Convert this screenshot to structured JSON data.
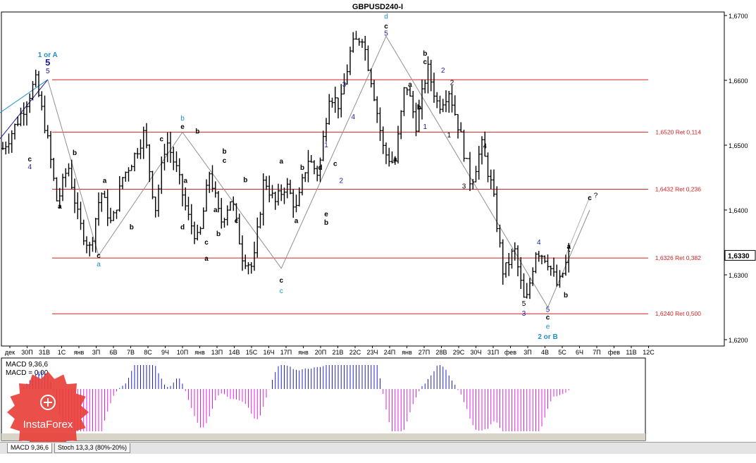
{
  "chart_data": {
    "type": "ohlc",
    "title": "GBPUSD240-I",
    "symbol": "GBPUSD",
    "timeframe": "H4",
    "ylim": [
      1.618,
      1.6715
    ],
    "y_ticks": [
      1.62,
      1.63,
      1.64,
      1.65,
      1.66,
      1.67
    ],
    "y_tick_labels": [
      "1,6200",
      "1,6300",
      "1,6400",
      "1,6500",
      "1,6600",
      "1,6700"
    ],
    "current_price": 1.633,
    "current_price_label": "1,6330",
    "x_tick_labels": [
      "дек",
      "30П",
      "31В",
      "1С",
      "янв",
      "3П",
      "6В",
      "7В",
      "8С",
      "9Ч",
      "10П",
      "янв",
      "13П",
      "14В",
      "15С",
      "16Ч",
      "17П",
      "янв",
      "20П",
      "21В",
      "22С",
      "23Ч",
      "24П",
      "янв",
      "27П",
      "28В",
      "29С",
      "30Ч",
      "31П",
      "фев",
      "3П",
      "4В",
      "5С",
      "6Ч",
      "7П",
      "фев",
      "11В",
      "12С"
    ],
    "price_path": [
      1.6495,
      1.6525,
      1.656,
      1.66,
      1.652,
      1.641,
      1.647,
      1.638,
      1.634,
      1.643,
      1.6375,
      1.645,
      1.648,
      1.652,
      1.64,
      1.651,
      1.646,
      1.639,
      1.635,
      1.646,
      1.638,
      1.642,
      1.633,
      1.631,
      1.645,
      1.641,
      1.644,
      1.64,
      1.648,
      1.6455,
      1.658,
      1.656,
      1.665,
      1.667,
      1.659,
      1.649,
      1.647,
      1.66,
      1.653,
      1.662,
      1.656,
      1.6585,
      1.652,
      1.644,
      1.65,
      1.643,
      1.63,
      1.634,
      1.625,
      1.634,
      1.6325,
      1.628,
      1.633
    ],
    "horizontal_levels": [
      {
        "value": 1.6601,
        "label": ""
      },
      {
        "value": 1.652,
        "label": "1,6520 Ret 0,114"
      },
      {
        "value": 1.6432,
        "label": "1,6432 Ret 0,236"
      },
      {
        "value": 1.6326,
        "label": "1,6326 Ret 0,382"
      },
      {
        "value": 1.624,
        "label": "1,6240 Ret 0,500"
      }
    ],
    "wave_labels": [
      {
        "text": "d",
        "color": "#1e90c8",
        "bar": 128,
        "price": 1.6695
      },
      {
        "text": "c",
        "color": "#000000",
        "bar": 128,
        "price": 1.668
      },
      {
        "text": "5",
        "color": "#1a1aa0",
        "bar": 128,
        "price": 1.6669
      },
      {
        "text": "1 or A",
        "color": "#1e90c8",
        "bar": 15,
        "price": 1.6636
      },
      {
        "text": "5",
        "color": "#1a1aa0",
        "bar": 15,
        "price": 1.6623
      },
      {
        "text": "5",
        "color": "#1a1aa0",
        "bar": 15,
        "price": 1.6611
      },
      {
        "text": "b",
        "color": "#000000",
        "bar": 141,
        "price": 1.6638
      },
      {
        "text": "c",
        "color": "#000000",
        "bar": 141,
        "price": 1.6625
      },
      {
        "text": "2",
        "color": "#1a1aa0",
        "bar": 147,
        "price": 1.6612
      },
      {
        "text": "2",
        "color": "#000000",
        "bar": 150,
        "price": 1.6593
      },
      {
        "text": "a",
        "color": "#000000",
        "bar": 136,
        "price": 1.659
      },
      {
        "text": "3",
        "color": "#1a1aa0",
        "bar": 114,
        "price": 1.659
      },
      {
        "text": "4",
        "color": "#1a1aa0",
        "bar": 117,
        "price": 1.654
      },
      {
        "text": "b",
        "color": "#000000",
        "bar": 139,
        "price": 1.6555
      },
      {
        "text": "1",
        "color": "#1a1aa0",
        "bar": 141,
        "price": 1.6525
      },
      {
        "text": "1",
        "color": "#000000",
        "bar": 149,
        "price": 1.6512
      },
      {
        "text": "4",
        "color": "#000000",
        "bar": 161,
        "price": 1.6495
      },
      {
        "text": "3",
        "color": "#000000",
        "bar": 154,
        "price": 1.6433
      },
      {
        "text": "b",
        "color": "#1e90c8",
        "bar": 60,
        "price": 1.6538
      },
      {
        "text": "e",
        "color": "#000000",
        "bar": 60,
        "price": 1.6525
      },
      {
        "text": "b",
        "color": "#000000",
        "bar": 65,
        "price": 1.6518
      },
      {
        "text": "c",
        "color": "#000000",
        "bar": 53,
        "price": 1.6506
      },
      {
        "text": "4",
        "color": "#1a1aa0",
        "bar": 9,
        "price": 1.6463
      },
      {
        "text": "c",
        "color": "#000000",
        "bar": 9,
        "price": 1.6475
      },
      {
        "text": "b",
        "color": "#000000",
        "bar": 24,
        "price": 1.6485
      },
      {
        "text": "b",
        "color": "#000000",
        "bar": 74,
        "price": 1.6487
      },
      {
        "text": "c",
        "color": "#000000",
        "bar": 74,
        "price": 1.6473
      },
      {
        "text": "b",
        "color": "#000000",
        "bar": 81,
        "price": 1.6443
      },
      {
        "text": "1",
        "color": "#1a1aa0",
        "bar": 108,
        "price": 1.6497
      },
      {
        "text": "2",
        "color": "#1a1aa0",
        "bar": 113,
        "price": 1.6442
      },
      {
        "text": "a",
        "color": "#000000",
        "bar": 93,
        "price": 1.6472
      },
      {
        "text": "b",
        "color": "#000000",
        "bar": 100,
        "price": 1.6462
      },
      {
        "text": "d",
        "color": "#000000",
        "bar": 106,
        "price": 1.6462
      },
      {
        "text": "c",
        "color": "#000000",
        "bar": 111,
        "price": 1.6468
      },
      {
        "text": "a",
        "color": "#000000",
        "bar": 19,
        "price": 1.6402
      },
      {
        "text": "a",
        "color": "#000000",
        "bar": 34,
        "price": 1.6442
      },
      {
        "text": "a",
        "color": "#000000",
        "bar": 61,
        "price": 1.6442
      },
      {
        "text": "a",
        "color": "#000000",
        "bar": 131,
        "price": 1.6475
      },
      {
        "text": "a",
        "color": "#000000",
        "bar": 71,
        "price": 1.6397
      },
      {
        "text": "a",
        "color": "#000000",
        "bar": 98,
        "price": 1.638
      },
      {
        "text": "b",
        "color": "#000000",
        "bar": 43,
        "price": 1.637
      },
      {
        "text": "c",
        "color": "#000000",
        "bar": 78,
        "price": 1.638
      },
      {
        "text": "e",
        "color": "#000000",
        "bar": 108,
        "price": 1.639
      },
      {
        "text": "b",
        "color": "#000000",
        "bar": 108,
        "price": 1.6377
      },
      {
        "text": "d",
        "color": "#000000",
        "bar": 60,
        "price": 1.637
      },
      {
        "text": "b",
        "color": "#000000",
        "bar": 72,
        "price": 1.636
      },
      {
        "text": "c",
        "color": "#000000",
        "bar": 68,
        "price": 1.6347
      },
      {
        "text": "c",
        "color": "#000000",
        "bar": 32,
        "price": 1.6326
      },
      {
        "text": "a",
        "color": "#1e90c8",
        "bar": 32,
        "price": 1.6313
      },
      {
        "text": "a",
        "color": "#000000",
        "bar": 68,
        "price": 1.6322
      },
      {
        "text": "c",
        "color": "#000000",
        "bar": 93,
        "price": 1.6288
      },
      {
        "text": "c",
        "color": "#1e90c8",
        "bar": 93,
        "price": 1.6272
      },
      {
        "text": "4",
        "color": "#1a1aa0",
        "bar": 179,
        "price": 1.6347
      },
      {
        "text": "a",
        "color": "#000000",
        "bar": 189,
        "price": 1.634
      },
      {
        "text": "b",
        "color": "#000000",
        "bar": 188,
        "price": 1.6265
      },
      {
        "text": "5",
        "color": "#000000",
        "bar": 174,
        "price": 1.6252
      },
      {
        "text": "5",
        "color": "#1a1aa0",
        "bar": 182,
        "price": 1.6243
      },
      {
        "text": "3",
        "color": "#1a1aa0",
        "bar": 174,
        "price": 1.6237
      },
      {
        "text": "c",
        "color": "#000000",
        "bar": 182,
        "price": 1.6231
      },
      {
        "text": "e",
        "color": "#1e90c8",
        "bar": 182,
        "price": 1.6217
      },
      {
        "text": "2 or B",
        "color": "#1e90c8",
        "bar": 182,
        "price": 1.6201
      },
      {
        "text": "c",
        "color": "#000000",
        "bar": 196,
        "price": 1.6415
      },
      {
        "text": "?",
        "color": "#000000",
        "bar": 198,
        "price": 1.6419
      }
    ],
    "macd": {
      "label_line1": "MACD 9,36,6",
      "label_line2": "MACD = 0,00",
      "range": [
        -0.01,
        0.01
      ]
    },
    "bottom_tabs": [
      "MACD 9,36,6",
      "Stoch 13,3,3 (80%-20%)"
    ],
    "watermark": "InstaForex"
  }
}
